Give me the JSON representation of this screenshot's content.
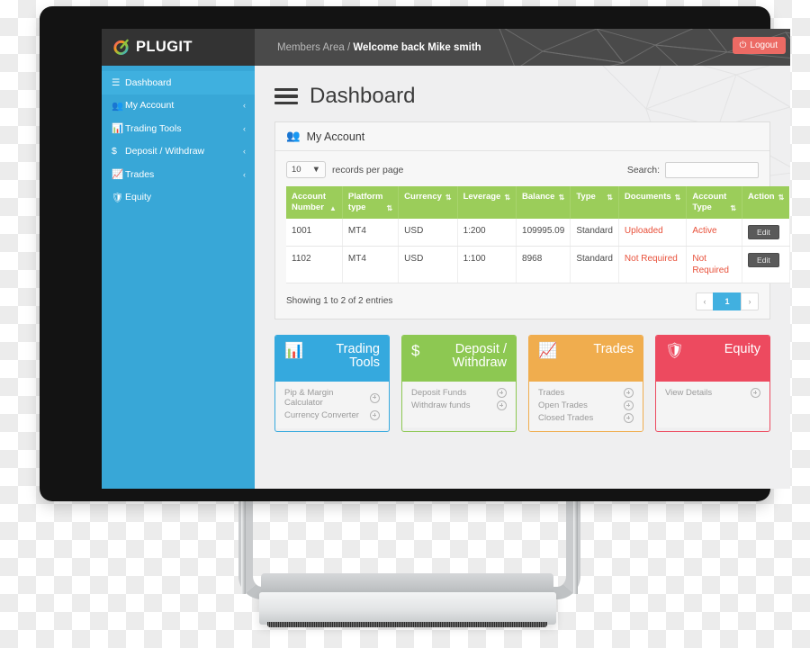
{
  "header": {
    "logo_text": "PLUGIT",
    "logo_icon": "plugit-circle-logo",
    "breadcrumb_root": "Members Area",
    "breadcrumb_sep": " / ",
    "breadcrumb_current": "Welcome back Mike smith",
    "logout_label": "Logout",
    "logout_icon": "power-icon",
    "bg_color": "#3c3c3c",
    "logout_color": "#ec6a64"
  },
  "sidebar": {
    "accent_color": "#38a7d7",
    "items": [
      {
        "label": "Dashboard",
        "icon": "hamburger-icon",
        "caret": "",
        "active": true
      },
      {
        "label": "My Account",
        "icon": "users-icon",
        "caret": "‹",
        "active": false
      },
      {
        "label": "Trading Tools",
        "icon": "bar-chart-icon",
        "caret": "‹",
        "active": false
      },
      {
        "label": "Deposit / Withdraw",
        "icon": "dollar-icon",
        "caret": "‹",
        "active": false
      },
      {
        "label": "Trades",
        "icon": "signal-icon",
        "caret": "‹",
        "active": false
      },
      {
        "label": "Equity",
        "icon": "shield-icon",
        "caret": "",
        "active": false
      }
    ]
  },
  "main": {
    "page_title": "Dashboard",
    "page_title_icon": "hamburger-icon",
    "panel": {
      "title": "My Account",
      "icon": "users-icon",
      "per_page_value": "10",
      "per_page_label": "records per page",
      "search_label": "Search:",
      "search_value": "",
      "search_placeholder": "",
      "table": {
        "header_color": "#9bcd5a",
        "columns": [
          {
            "label": "Account Number",
            "sort": "▲"
          },
          {
            "label": "Platform type",
            "sort": "⇅"
          },
          {
            "label": "Currency",
            "sort": "⇅"
          },
          {
            "label": "Leverage",
            "sort": "⇅"
          },
          {
            "label": "Balance",
            "sort": "⇅"
          },
          {
            "label": "Type",
            "sort": "⇅"
          },
          {
            "label": "Documents",
            "sort": "⇅"
          },
          {
            "label": "Account Type",
            "sort": "⇅"
          },
          {
            "label": "Action",
            "sort": "⇅"
          }
        ],
        "rows": [
          {
            "account_number": "1001",
            "platform_type": "MT4",
            "currency": "USD",
            "leverage": "1:200",
            "balance": "109995.09",
            "type": "Standard",
            "documents": "Uploaded",
            "account_type": "Active",
            "action": "Edit"
          },
          {
            "account_number": "1102",
            "platform_type": "MT4",
            "currency": "USD",
            "leverage": "1:100",
            "balance": "8968",
            "type": "Standard",
            "documents": "Not Required",
            "account_type": "Not Required",
            "action": "Edit"
          }
        ],
        "alert_color": "#e8503a"
      },
      "showing_text": "Showing 1 to 2 of 2 entries",
      "pager": {
        "prev": "‹",
        "current": "1",
        "next": "›"
      }
    },
    "cards": [
      {
        "title": "Trading Tools",
        "icon": "bar-chart-icon",
        "color": "#35a9de",
        "links": [
          "Pip & Margin Calculator",
          "Currency Converter"
        ]
      },
      {
        "title": "Deposit / Withdraw",
        "icon": "dollar-icon",
        "color": "#8dc852",
        "links": [
          "Deposit Funds",
          "Withdraw funds"
        ]
      },
      {
        "title": "Trades",
        "icon": "signal-icon",
        "color": "#f0ad4e",
        "links": [
          "Trades",
          "Open Trades",
          "Closed Trades"
        ]
      },
      {
        "title": "Equity",
        "icon": "shield-icon",
        "color": "#ed4a5f",
        "links": [
          "View Details"
        ]
      }
    ]
  }
}
